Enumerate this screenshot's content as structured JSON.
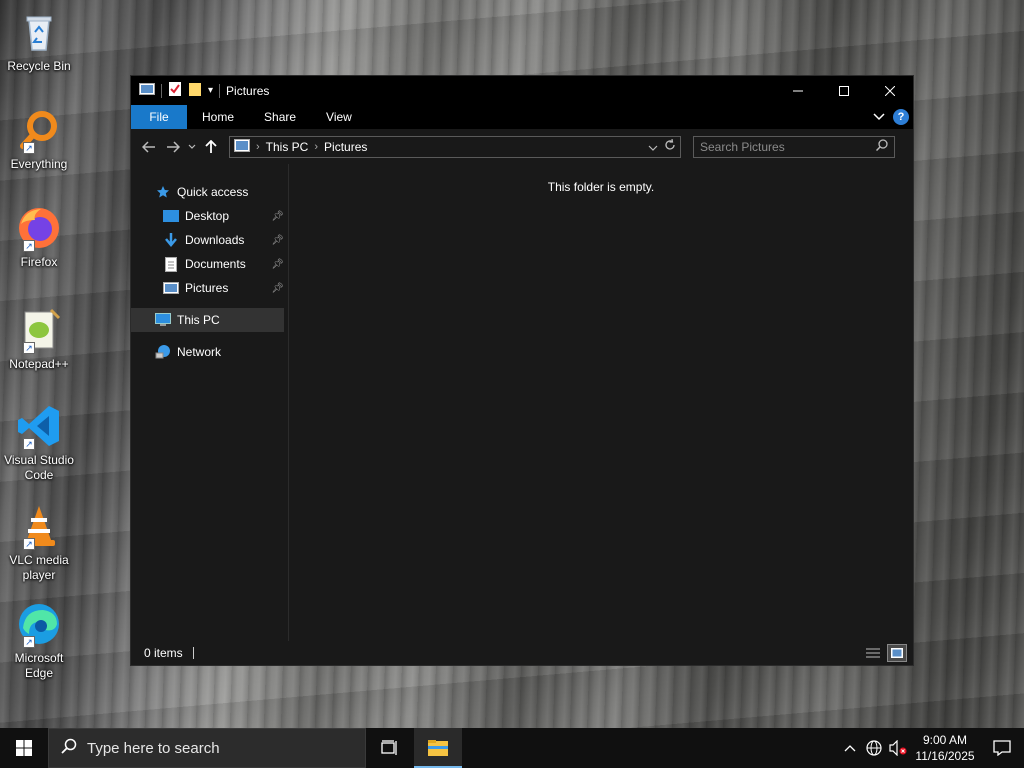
{
  "desktop": {
    "icons": [
      {
        "label": "Recycle Bin",
        "icon": "recycle-bin-icon"
      },
      {
        "label": "Everything",
        "icon": "everything-icon"
      },
      {
        "label": "Firefox",
        "icon": "firefox-icon"
      },
      {
        "label": "Notepad++",
        "icon": "notepad-plus-plus-icon"
      },
      {
        "label": "Visual Studio Code",
        "icon": "vscode-icon"
      },
      {
        "label": "VLC media player",
        "icon": "vlc-icon"
      },
      {
        "label": "Microsoft Edge",
        "icon": "edge-icon"
      }
    ]
  },
  "window": {
    "title": "Pictures",
    "ribbon_tabs": [
      "File",
      "Home",
      "Share",
      "View"
    ],
    "address": {
      "segments": [
        "This PC",
        "Pictures"
      ]
    },
    "search": {
      "placeholder": "Search Pictures"
    },
    "nav_pane": {
      "quick_access": "Quick access",
      "pinned": [
        "Desktop",
        "Downloads",
        "Documents",
        "Pictures"
      ],
      "this_pc": "This PC",
      "network": "Network"
    },
    "content": {
      "empty_message": "This folder is empty."
    },
    "status": {
      "items": "0 items"
    }
  },
  "taskbar": {
    "search_placeholder": "Type here to search",
    "time": "9:00 AM",
    "date": "11/16/2025"
  },
  "colors": {
    "accent": "#1979ca",
    "window_bg": "#191919",
    "titlebar_bg": "#000000",
    "taskbar_bg": "#101010"
  }
}
